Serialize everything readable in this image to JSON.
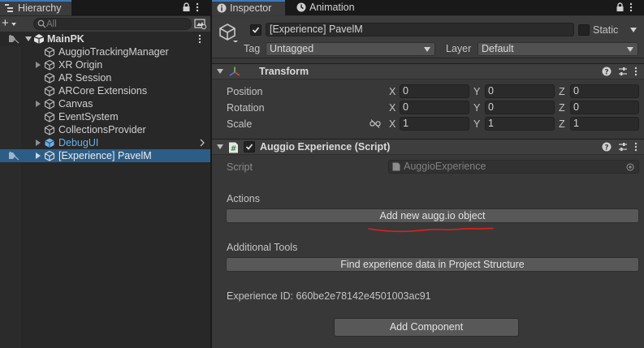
{
  "hierarchy": {
    "tab_label": "Hierarchy",
    "search_placeholder": "All",
    "add_label": "+",
    "items": [
      {
        "label": "MainPK",
        "bold": true
      },
      {
        "label": "AuggioTrackingManager"
      },
      {
        "label": "XR Origin"
      },
      {
        "label": "AR Session"
      },
      {
        "label": "ARCore Extensions"
      },
      {
        "label": "Canvas"
      },
      {
        "label": "EventSystem"
      },
      {
        "label": "CollectionsProvider"
      },
      {
        "label": "DebugUI"
      },
      {
        "label": "[Experience] PavelM",
        "selected": true
      }
    ]
  },
  "inspector": {
    "tabs": [
      {
        "label": "Inspector",
        "icon": "info-icon",
        "active": true
      },
      {
        "label": "Animation",
        "icon": "animation-clock-icon",
        "active": false
      }
    ],
    "object_name": "[Experience] PavelM",
    "static_label": "Static",
    "tag_label": "Tag",
    "tag_value": "Untagged",
    "layer_label": "Layer",
    "layer_value": "Default",
    "transform": {
      "title": "Transform",
      "rows": [
        {
          "label": "Position",
          "x": "0",
          "y": "0",
          "z": "0"
        },
        {
          "label": "Rotation",
          "x": "0",
          "y": "0",
          "z": "0"
        },
        {
          "label": "Scale",
          "x": "1",
          "y": "1",
          "z": "1"
        }
      ],
      "axis_x": "X",
      "axis_y": "Y",
      "axis_z": "Z"
    },
    "script_component": {
      "title": "Auggio Experience (Script)",
      "script_label": "Script",
      "script_value": "AuggioExperience",
      "actions_label": "Actions",
      "add_button": "Add new augg.io object",
      "tools_label": "Additional Tools",
      "find_button": "Find experience data in Project Structure",
      "experience_id": "Experience ID: 660be2e78142e4501003ac91"
    },
    "add_component_label": "Add Component"
  },
  "colors": {
    "selection": "#2c5d87",
    "tab_accent": "#3a79bb",
    "annotation_red": "#e0201c",
    "prefab_blue": "#6ab0ea"
  }
}
